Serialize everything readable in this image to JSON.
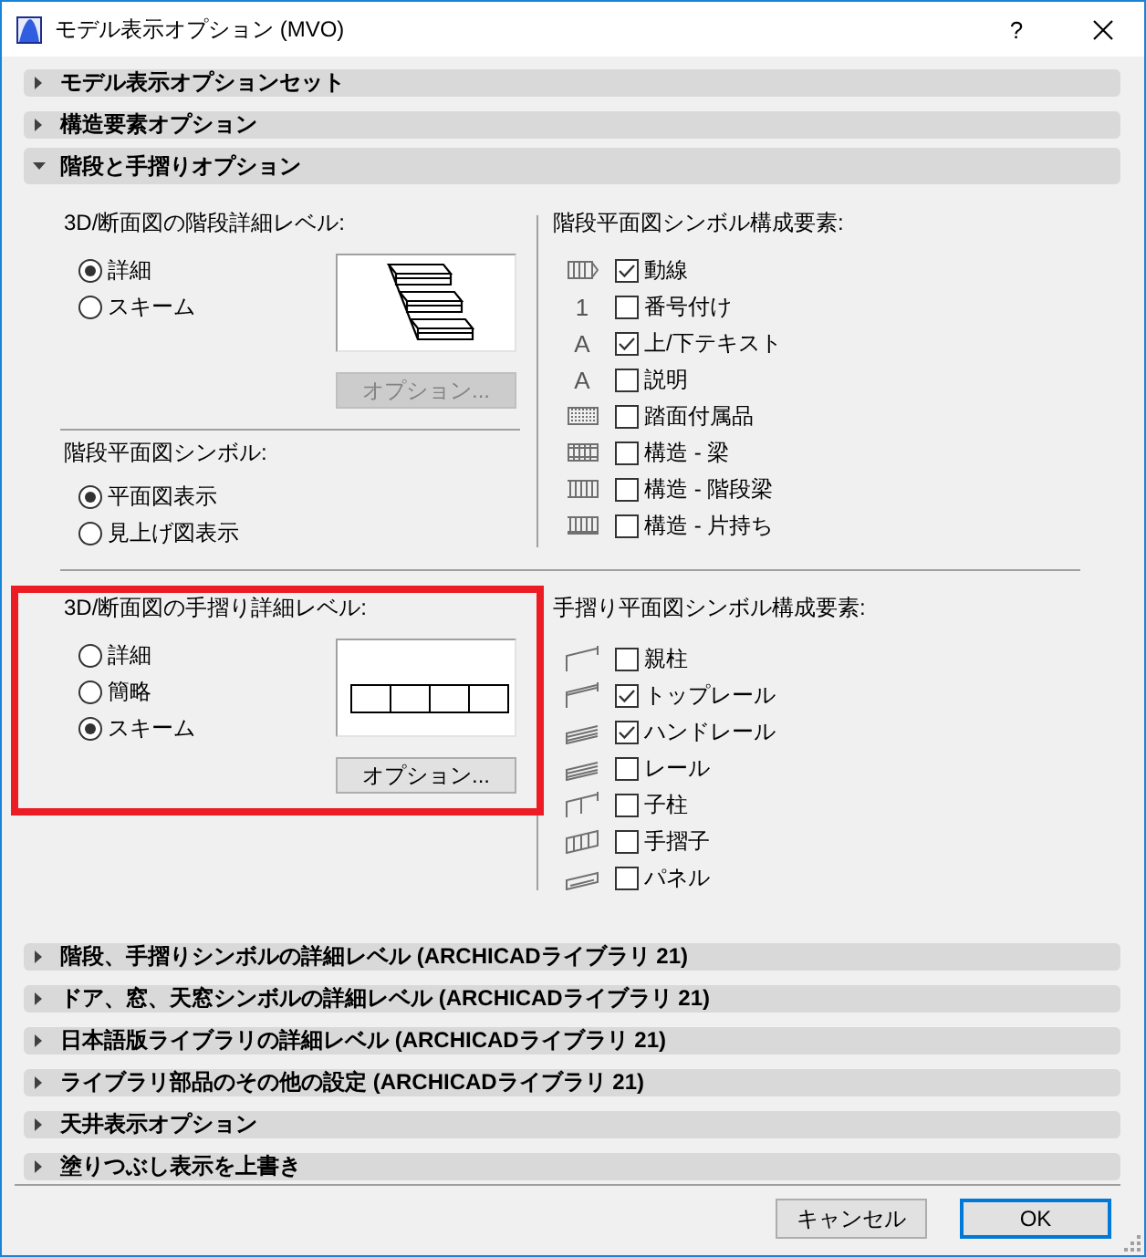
{
  "window": {
    "title": "モデル表示オプション (MVO)",
    "help": "?"
  },
  "sections": [
    {
      "title": "モデル表示オプションセット",
      "expanded": false
    },
    {
      "title": "構造要素オプション",
      "expanded": false
    },
    {
      "title": "階段と手摺りオプション",
      "expanded": true,
      "content": {
        "stair_detail": {
          "label": "3D/断面図の階段詳細レベル:",
          "options": [
            {
              "label": "詳細",
              "selected": true
            },
            {
              "label": "スキーム",
              "selected": false
            }
          ],
          "options_button": {
            "label": "オプション...",
            "disabled": true
          }
        },
        "stair_symbol": {
          "label": "階段平面図シンボル:",
          "options": [
            {
              "label": "平面図表示",
              "selected": true
            },
            {
              "label": "見上げ図表示",
              "selected": false
            }
          ]
        },
        "stair_components": {
          "label": "階段平面図シンボル構成要素:",
          "items": [
            {
              "kind": "icon",
              "label": "動線",
              "checked": true
            },
            {
              "kind": "glyph",
              "glyph": "1",
              "label": "番号付け",
              "checked": false
            },
            {
              "kind": "glyph",
              "glyph": "A",
              "label": "上/下テキスト",
              "checked": true
            },
            {
              "kind": "glyph",
              "glyph": "A",
              "label": "説明",
              "checked": false
            },
            {
              "kind": "icon",
              "label": "踏面付属品",
              "checked": false
            },
            {
              "kind": "icon",
              "label": "構造 - 梁",
              "checked": false
            },
            {
              "kind": "icon",
              "label": "構造 - 階段梁",
              "checked": false
            },
            {
              "kind": "icon",
              "label": "構造 - 片持ち",
              "checked": false
            }
          ]
        },
        "railing_detail": {
          "label": "3D/断面図の手摺り詳細レベル:",
          "highlighted": true,
          "options": [
            {
              "label": "詳細",
              "selected": false
            },
            {
              "label": "簡略",
              "selected": false
            },
            {
              "label": "スキーム",
              "selected": true
            }
          ],
          "options_button": {
            "label": "オプション...",
            "disabled": false
          }
        },
        "railing_components": {
          "label": "手摺り平面図シンボル構成要素:",
          "items": [
            {
              "label": "親柱",
              "checked": false
            },
            {
              "label": "トップレール",
              "checked": true
            },
            {
              "label": "ハンドレール",
              "checked": true
            },
            {
              "label": "レール",
              "checked": false
            },
            {
              "label": "子柱",
              "checked": false
            },
            {
              "label": "手摺子",
              "checked": false
            },
            {
              "label": "パネル",
              "checked": false
            }
          ]
        }
      }
    },
    {
      "title": "階段、手摺りシンボルの詳細レベル (ARCHICADライブラリ 21)",
      "expanded": false
    },
    {
      "title": "ドア、窓、天窓シンボルの詳細レベル (ARCHICADライブラリ 21)",
      "expanded": false
    },
    {
      "title": "日本語版ライブラリの詳細レベル (ARCHICADライブラリ 21)",
      "expanded": false
    },
    {
      "title": "ライブラリ部品のその他の設定 (ARCHICADライブラリ 21)",
      "expanded": false
    },
    {
      "title": "天井表示オプション",
      "expanded": false
    },
    {
      "title": "塗りつぶし表示を上書き",
      "expanded": false
    }
  ],
  "buttons": [
    {
      "label": "キャンセル",
      "default": false
    },
    {
      "label": "OK",
      "default": true
    }
  ]
}
